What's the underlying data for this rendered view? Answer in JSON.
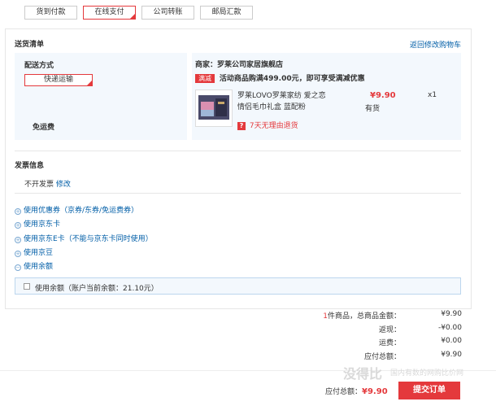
{
  "payment_methods": [
    {
      "label": "货到付款",
      "active": false
    },
    {
      "label": "在线支付",
      "active": true
    },
    {
      "label": "公司转账",
      "active": false
    },
    {
      "label": "邮局汇款",
      "active": false
    }
  ],
  "shipping": {
    "title": "送货清单",
    "back_link": "返回修改购物车",
    "method_label": "配送方式",
    "method_option": "快递运输",
    "free_shipping": "免运费",
    "merchant_label": "商家：",
    "merchant_name": "罗莱公司家居旗舰店",
    "promo_badge": "满减",
    "promo_text": "活动商品购满499.00元，即可享受满减优惠",
    "product": {
      "name": "罗莱LOVO罗莱家纺 爱之恋情侣毛巾礼盒 蓝配粉",
      "price": "¥9.90",
      "qty": "x1",
      "stock": "有货",
      "return_badge": "?",
      "return_text": "7天无理由退货"
    }
  },
  "invoice": {
    "title": "发票信息",
    "value": "不开发票",
    "edit": "修改"
  },
  "options": [
    {
      "icon": "+",
      "label": "使用优惠券（京券/东券/免运费券）"
    },
    {
      "icon": "+",
      "label": "使用京东卡"
    },
    {
      "icon": "+",
      "label": "使用京东E卡（不能与京东卡同时使用）"
    },
    {
      "icon": "+",
      "label": "使用京豆"
    },
    {
      "icon": "−",
      "label": "使用余额"
    }
  ],
  "balance": {
    "label": "使用余额（账户当前余额：21.10元）"
  },
  "summary": {
    "count": "1",
    "count_suffix": "件商品，总商品金额：",
    "total_goods": "¥9.90",
    "cashback_label": "返现：",
    "cashback": "-¥0.00",
    "shipping_label": "运费：",
    "shipping": "¥0.00",
    "payable_label": "应付总额：",
    "payable": "¥9.90"
  },
  "footer": {
    "payable_label": "应付总额：",
    "payable": "¥9.90",
    "submit": "提交订单",
    "watermark": "没得比",
    "watermark_tagline": "国内有数的网购比价网"
  },
  "colors": {
    "accent": "#e4393c",
    "link": "#005ea7",
    "panel": "#f3f8fd"
  }
}
